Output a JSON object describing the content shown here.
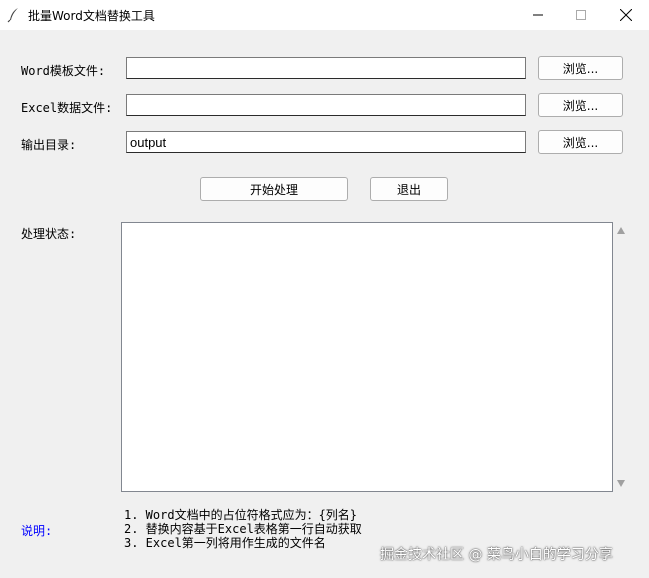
{
  "window": {
    "title": "批量Word文档替换工具",
    "controls": {
      "minimize_icon": "minimize-icon",
      "maximize_icon": "maximize-icon",
      "close_icon": "close-icon"
    }
  },
  "form": {
    "word_label": "Word模板文件:",
    "word_value": "",
    "excel_label": "Excel数据文件:",
    "excel_value": "",
    "output_label": "输出目录:",
    "output_value": "output",
    "browse_label": "浏览..."
  },
  "actions": {
    "start_label": "开始处理",
    "exit_label": "退出"
  },
  "status": {
    "label": "处理状态:",
    "content": ""
  },
  "notes": {
    "label": "说明:",
    "label_color": "#0000ff",
    "lines": [
      "1. Word文档中的占位符格式应为：{列名}",
      "2. 替换内容基于Excel表格第一行自动获取",
      "3. Excel第一列将用作生成的文件名"
    ]
  },
  "watermark": "掘金技术社区 @ 菜鸟小白的学习分享"
}
